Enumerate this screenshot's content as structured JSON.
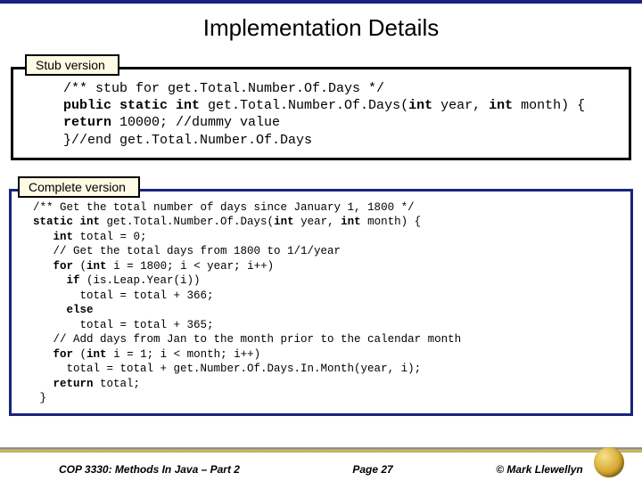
{
  "title": "Implementation Details",
  "stub_label": "Stub version",
  "complete_label": "Complete version",
  "stub_code_html": "/** stub for get.Total.Number.Of.Days */\n<span class=\"kw\">public static int </span>get.Total.Number.Of.Days(<span class=\"kw\">int</span> year, <span class=\"kw\">int</span> month) {\n<span class=\"kw\">return</span> 10000; //dummy value\n}//end get.Total.Number.Of.Days",
  "complete_code_html": "/** Get the total number of days since January 1, 1800 */\n<span class=\"kw\">static int</span> get.Total.Number.Of.Days(<span class=\"kw\">int</span> year, <span class=\"kw\">int</span> month) {\n   <span class=\"kw\">int</span> total = 0;\n   // Get the total days from 1800 to 1/1/year\n   <span class=\"kw\">for</span> (<span class=\"kw\">int</span> i = 1800; i &lt; year; i++)\n     <span class=\"kw\">if</span> (is.Leap.Year(i))\n       total = total + 366;\n     <span class=\"kw\">else</span>\n       total = total + 365;\n   // Add days from Jan to the month prior to the calendar month\n   <span class=\"kw\">for</span> (<span class=\"kw\">int</span> i = 1; i &lt; month; i++)\n     total = total + get.Number.Of.Days.In.Month(year, i);\n   <span class=\"kw\">return</span> total;\n }",
  "footer": {
    "course": "COP 3330:  Methods In Java – Part 2",
    "page": "Page 27",
    "copyright": "© Mark Llewellyn"
  }
}
